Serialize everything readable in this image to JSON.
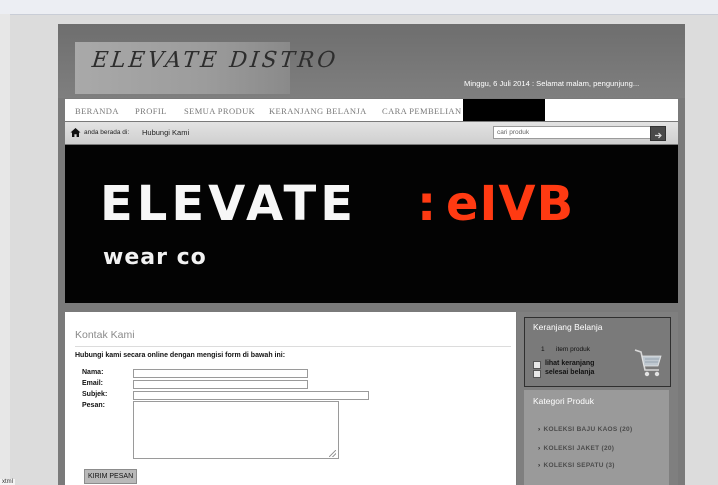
{
  "header": {
    "logo_text": "ELEVATE DISTRO",
    "greeting": "Minggu, 6 Juli 2014 : Selamat malam, pengunjung..."
  },
  "nav": {
    "items": [
      {
        "label": "BERANDA"
      },
      {
        "label": "PROFIL"
      },
      {
        "label": "SEMUA PRODUK"
      },
      {
        "label": "KERANJANG BELANJA"
      },
      {
        "label": "CARA PEMBELIAN"
      }
    ]
  },
  "breadcrumb": {
    "prefix": "anda berada di:",
    "page": "Hubungi Kami"
  },
  "search": {
    "value": "cari produk"
  },
  "banner": {
    "word": "ELEVATE",
    "colon": ":",
    "brand": "eIVB",
    "sub": "wear co"
  },
  "contact": {
    "title": "Kontak Kami",
    "intro": "Hubungi kami secara online dengan mengisi form di bawah ini:",
    "fields": {
      "name": "Nama:",
      "email": "Email:",
      "subject": "Subjek:",
      "message": "Pesan:"
    },
    "submit_label": "KIRIM PESAN"
  },
  "cart": {
    "title": "Keranjang Belanja",
    "count": "1",
    "unit": "item produk",
    "links": [
      "lihat keranjang",
      "selesai belanja"
    ]
  },
  "categories": {
    "title": "Kategori Produk",
    "items": [
      {
        "label": "KOLEKSI BAJU KAOS (20)"
      },
      {
        "label": "KOLEKSI JAKET (20)"
      },
      {
        "label": "KOLEKSI SEPATU (3)"
      }
    ]
  },
  "status": {
    "corner_text": "xtml"
  },
  "colors": {
    "frame": "#7a7a7a",
    "banner_bg": "#030303",
    "brand_accent": "#ff3a12"
  }
}
